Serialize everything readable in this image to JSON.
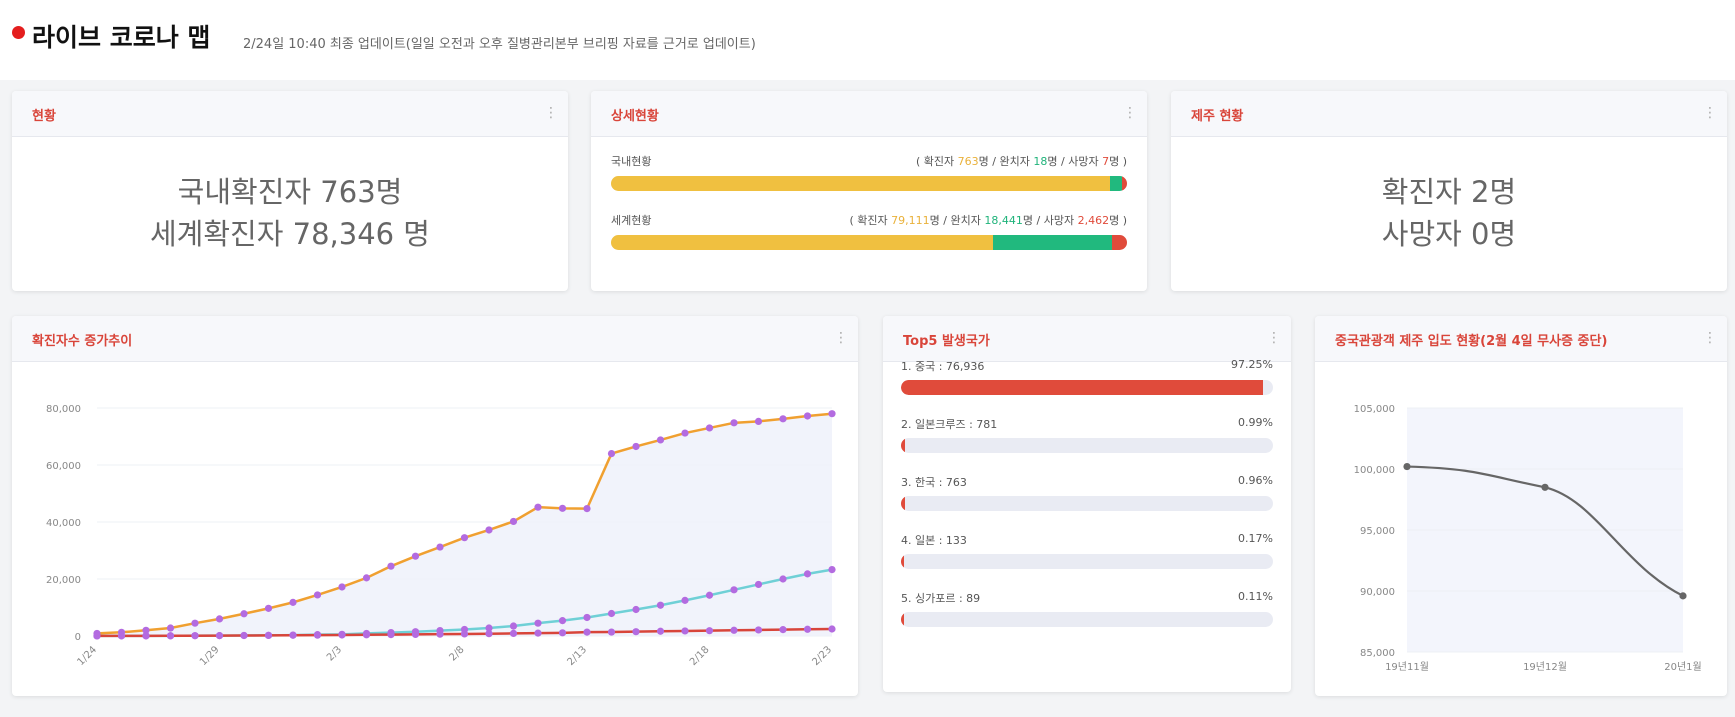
{
  "header": {
    "title": "라이브 코로나 맵",
    "subtitle": "2/24일 10:40 최종 업데이트(일일 오전과 오후 질병관리본부 브리핑 자료를 근거로 업데이트)"
  },
  "status_card": {
    "title": "현황",
    "domestic": "국내확진자 763명",
    "world": "세계확진자 78,346 명"
  },
  "detail_card": {
    "title": "상세현황",
    "domestic": {
      "label": "국내현황",
      "confirmed_label": "확진자",
      "confirmed": "763",
      "recovered_label": "완치자",
      "recovered": "18",
      "dead_label": "사망자",
      "dead": "7",
      "unit": "명",
      "shares": {
        "confirmed": 0.967,
        "recovered": 0.024,
        "dead": 0.009
      }
    },
    "world": {
      "label": "세계현황",
      "confirmed_label": "확진자",
      "confirmed": "79,111",
      "recovered_label": "완치자",
      "recovered": "18,441",
      "dead_label": "사망자",
      "dead": "2,462",
      "unit": "명",
      "shares": {
        "confirmed": 0.74,
        "recovered": 0.23,
        "dead": 0.03
      }
    }
  },
  "jeju_card": {
    "title": "제주 현황",
    "confirmed": "확진자 2명",
    "dead": "사망자 0명"
  },
  "top5_card": {
    "title": "Top5 발생국가",
    "items": [
      {
        "label": "1. 중국 : 76,936",
        "pct": "97.25%",
        "value": 0.9725
      },
      {
        "label": "2. 일본크루즈 : 781",
        "pct": "0.99%",
        "value": 0.0099
      },
      {
        "label": "3. 한국 : 763",
        "pct": "0.96%",
        "value": 0.0096
      },
      {
        "label": "4. 일본 : 133",
        "pct": "0.17%",
        "value": 0.0017
      },
      {
        "label": "5. 싱가포르 : 89",
        "pct": "0.11%",
        "value": 0.0011
      }
    ]
  },
  "trend_card": {
    "title": "확진자수 증가추이"
  },
  "tourist_card": {
    "title": "중국관광객 제주 입도 현황(2월 4일 무사증 중단)"
  },
  "colors": {
    "accent_red": "#e04b3b",
    "yellow": "#f0c040",
    "green": "#21b97e",
    "orange_line": "#f0a030",
    "cyan_line": "#6fd0d6",
    "red_line": "#d8453a",
    "point": "#b36be0",
    "gray_line": "#666666"
  },
  "chart_data": [
    {
      "type": "line",
      "title": "확진자수 증가추이",
      "x_tick_labels": [
        "1/24",
        "1/29",
        "2/3",
        "2/8",
        "2/13",
        "2/18",
        "2/23"
      ],
      "y_tick_labels": [
        "0",
        "20,000",
        "40,000",
        "60,000",
        "80,000"
      ],
      "ylim": [
        0,
        80000
      ],
      "x": [
        "1/24",
        "1/25",
        "1/26",
        "1/27",
        "1/28",
        "1/29",
        "1/30",
        "1/31",
        "2/1",
        "2/2",
        "2/3",
        "2/4",
        "2/5",
        "2/6",
        "2/7",
        "2/8",
        "2/9",
        "2/10",
        "2/11",
        "2/12",
        "2/13",
        "2/14",
        "2/15",
        "2/16",
        "2/17",
        "2/18",
        "2/19",
        "2/20",
        "2/21",
        "2/22",
        "2/23"
      ],
      "series": [
        {
          "color": "orange",
          "values": [
            900,
            1300,
            2000,
            2800,
            4500,
            6000,
            7800,
            9700,
            11800,
            14400,
            17200,
            20400,
            24500,
            28000,
            31200,
            34500,
            37200,
            40200,
            45200,
            44800,
            44700,
            64000,
            66500,
            68800,
            71200,
            73000,
            74800,
            75300,
            76200,
            77200,
            78000
          ]
        },
        {
          "color": "cyan",
          "values": [
            30,
            40,
            50,
            60,
            110,
            130,
            170,
            240,
            320,
            480,
            590,
            900,
            1200,
            1500,
            1900,
            2300,
            2800,
            3500,
            4500,
            5400,
            6500,
            7900,
            9300,
            10800,
            12500,
            14300,
            16200,
            18100,
            20000,
            21800,
            23300
          ]
        },
        {
          "color": "red",
          "values": [
            25,
            40,
            55,
            80,
            105,
            130,
            170,
            210,
            260,
            300,
            360,
            420,
            490,
            560,
            640,
            720,
            810,
            910,
            1010,
            1110,
            1360,
            1390,
            1520,
            1670,
            1770,
            1870,
            2010,
            2120,
            2240,
            2360,
            2460
          ]
        }
      ]
    },
    {
      "type": "line",
      "title": "중국관광객 제주 입도 현황(2월 4일 무사증 중단)",
      "categories": [
        "19년11월",
        "19년12월",
        "20년1월"
      ],
      "y_tick_labels": [
        "85,000",
        "90,000",
        "95,000",
        "100,000",
        "105,000"
      ],
      "ylim": [
        85000,
        105000
      ],
      "values": [
        100200,
        98500,
        89600
      ]
    }
  ]
}
